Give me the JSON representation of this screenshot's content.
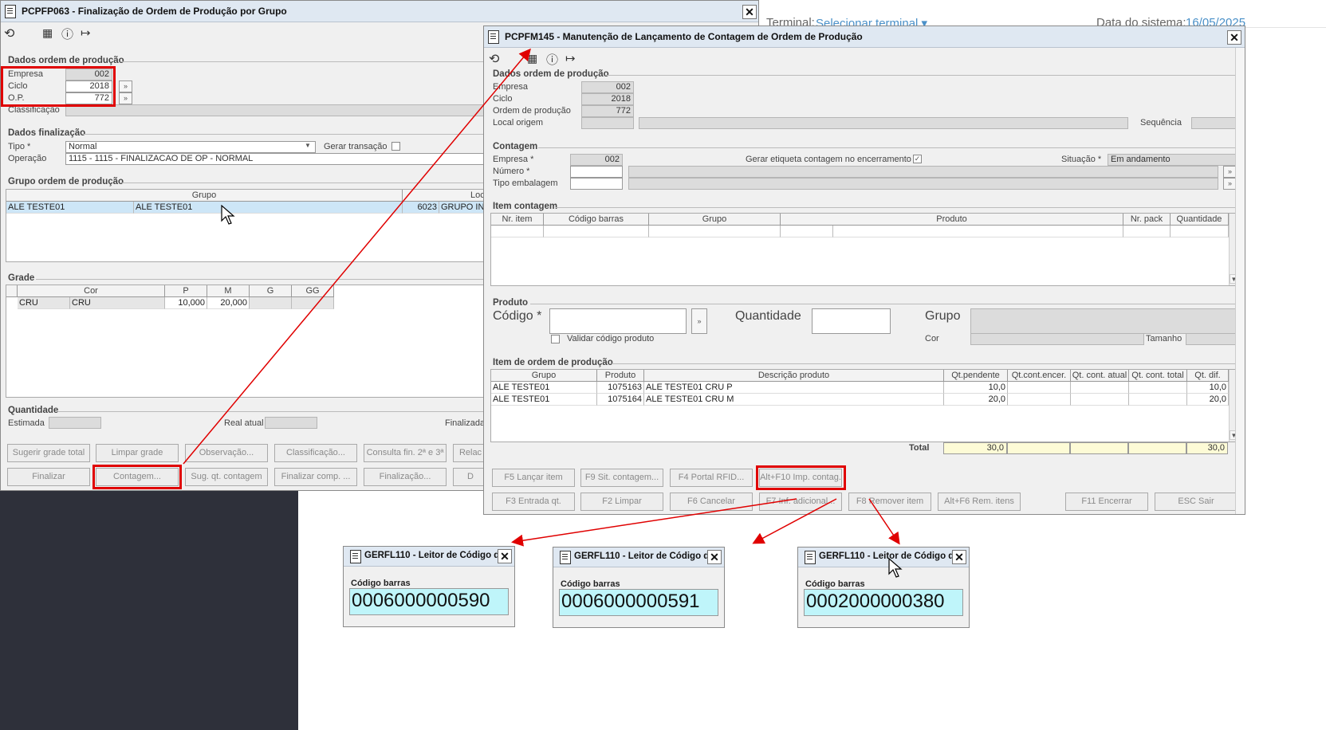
{
  "bg": {
    "terminal_label": "Terminal:",
    "terminal_value": "Selecionar terminal ▾",
    "date_label": "Data do sistema:",
    "date_value": "16/05/2025"
  },
  "win1": {
    "title": "PCPFP063 - Finalização de Ordem de Produção por Grupo",
    "section_dados_op": "Dados ordem de produção",
    "empresa_label": "Empresa",
    "empresa_value": "002",
    "ciclo_label": "Ciclo",
    "ciclo_value": "2018",
    "op_label": "O.P.",
    "op_value": "772",
    "classificacao_label": "Classificação",
    "section_finalizacao": "Dados finalização",
    "tipo_label": "Tipo *",
    "tipo_value": "Normal",
    "gerar_transacao_label": "Gerar transação",
    "operacao_label": "Operação",
    "operacao_value": "1115 - 1115 - FINALIZACAO DE OP - NORMAL",
    "section_grupo": "Grupo ordem de produção",
    "grupo_headers": [
      "Grupo",
      "Loc"
    ],
    "grupo_row": [
      "ALE TESTE01",
      "ALE TESTE01",
      "6023",
      "GRUPO INTE"
    ],
    "section_grade": "Grade",
    "grade_headers": [
      "Cor",
      "P",
      "M",
      "G",
      "GG"
    ],
    "grade_row": [
      "CRU",
      "CRU",
      "10,000",
      "20,000"
    ],
    "section_quantidade": "Quantidade",
    "estimada_label": "Estimada",
    "real_atual_label": "Real atual",
    "finalizada_label": "Finalizada",
    "buttons_row1": [
      "Sugerir grade total",
      "Limpar grade",
      "Observação...",
      "Classificação...",
      "Consulta fin. 2ª e 3ª",
      "Relac"
    ],
    "buttons_row2": [
      "Finalizar",
      "Contagem...",
      "Sug. qt. contagem",
      "Finalizar comp. ...",
      "Finalização...",
      "D"
    ]
  },
  "win2": {
    "title": "PCPFM145 - Manutenção de Lançamento de Contagem de Ordem de Produção",
    "section_dados_op": "Dados ordem de produção",
    "empresa_label": "Empresa",
    "empresa_value": "002",
    "ciclo_label": "Ciclo",
    "ciclo_value": "2018",
    "ordem_label": "Ordem de produção",
    "ordem_value": "772",
    "local_label": "Local origem",
    "sequencia_label": "Sequência",
    "section_contagem": "Contagem",
    "c_empresa_label": "Empresa *",
    "c_empresa_value": "002",
    "gerar_etiqueta_label": "Gerar etiqueta contagem no encerramento",
    "situacao_label": "Situação *",
    "situacao_value": "Em andamento",
    "numero_label": "Número *",
    "tipo_embalagem_label": "Tipo embalagem",
    "section_item_contagem": "Item contagem",
    "item_headers": [
      "Nr. item",
      "Código barras",
      "Grupo",
      "Produto",
      "Nr. pack",
      "Quantidade"
    ],
    "section_produto": "Produto",
    "codigo_label": "Código *",
    "validar_label": "Validar código produto",
    "quantidade_label": "Quantidade",
    "grupo_label": "Grupo",
    "cor_label": "Cor",
    "tamanho_label": "Tamanho",
    "section_item_op": "Item de ordem de produção",
    "iop_headers": [
      "Grupo",
      "Produto",
      "Descrição produto",
      "Qt.pendente",
      "Qt.cont.encer.",
      "Qt. cont. atual",
      "Qt. cont. total",
      "Qt. dif."
    ],
    "iop_rows": [
      [
        "ALE TESTE01",
        "1075163",
        "ALE TESTE01 CRU P",
        "10,0",
        "",
        "",
        "",
        "10,0"
      ],
      [
        "ALE TESTE01",
        "1075164",
        "ALE TESTE01 CRU M",
        "20,0",
        "",
        "",
        "",
        "20,0"
      ]
    ],
    "total_label": "Total",
    "total_values": [
      "30,0",
      "",
      "",
      "",
      "30,0"
    ],
    "buttons_row1": [
      "F5 Lançar item",
      "F9 Sit. contagem...",
      "F4 Portal RFID...",
      "Alt+F10 Imp. contag."
    ],
    "buttons_row2": [
      "F3 Entrada qt.",
      "F2 Limpar",
      "F6 Cancelar",
      "F7 Inf. adicional...",
      "F8 Remover item",
      "Alt+F6 Rem. itens",
      "F11 Encerrar",
      "ESC Sair"
    ]
  },
  "readers": [
    {
      "title": "GERFL110 - Leitor de Código d...",
      "label": "Código barras",
      "value": "0006000000590"
    },
    {
      "title": "GERFL110 - Leitor de Código d...",
      "label": "Código barras",
      "value": "0006000000591"
    },
    {
      "title": "GERFL110 - Leitor de Código d...",
      "label": "Código barras",
      "value": "0002000000380"
    }
  ],
  "colors": {
    "highlight": "#e00000",
    "selection": "#cde6f7",
    "input_cyan": "#bff5fa",
    "dark_panel": "#2e303a"
  }
}
